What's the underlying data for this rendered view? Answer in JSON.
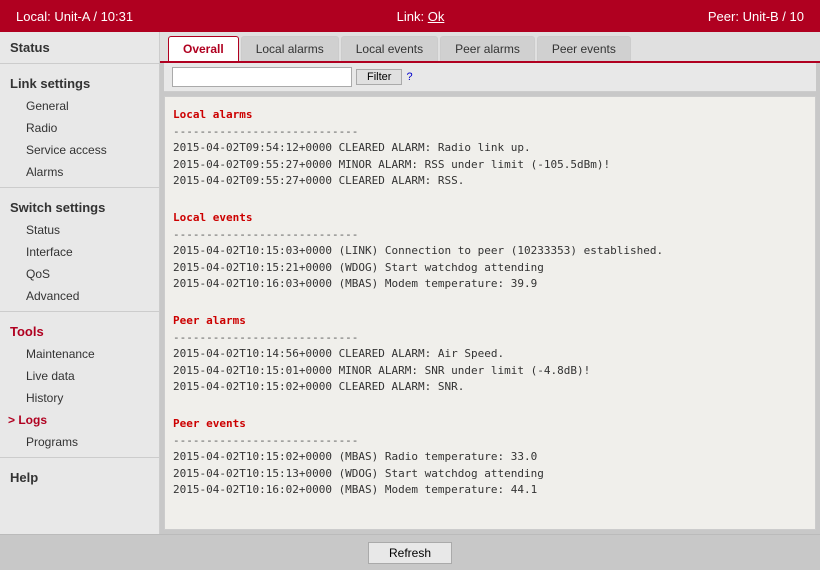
{
  "topbar": {
    "local_label": "Local:",
    "local_unit": "Unit-A",
    "local_time": "10:31",
    "link_label": "Link:",
    "link_status": "Ok",
    "peer_label": "Peer:",
    "peer_unit": "Unit-B / 10"
  },
  "sidebar": {
    "status_title": "Status",
    "link_settings_title": "Link settings",
    "link_items": [
      "General",
      "Radio",
      "Service access",
      "Alarms"
    ],
    "switch_settings_title": "Switch settings",
    "switch_items": [
      "Status",
      "Interface",
      "QoS",
      "Advanced"
    ],
    "tools_title": "Tools",
    "tools_items": [
      "Maintenance",
      "Live data",
      "History",
      "Logs",
      "Programs"
    ],
    "active_item": "Logs",
    "help_title": "Help"
  },
  "tabs": {
    "items": [
      "Overall",
      "Local alarms",
      "Local events",
      "Peer alarms",
      "Peer events"
    ],
    "active": "Overall"
  },
  "filter": {
    "placeholder": "",
    "button_label": "Filter",
    "help_label": "?"
  },
  "log": {
    "local_alarms_title": "Local alarms",
    "local_alarms_separator": "----------------------------",
    "local_alarms_lines": [
      "2015-04-02T09:54:12+0000 CLEARED ALARM: Radio link up.",
      "2015-04-02T09:55:27+0000 MINOR ALARM: RSS under limit (-105.5dBm)!",
      "2015-04-02T09:55:27+0000 CLEARED ALARM: RSS."
    ],
    "local_events_title": "Local events",
    "local_events_separator": "----------------------------",
    "local_events_lines": [
      "2015-04-02T10:15:03+0000 (LINK) Connection to peer (10233353) established.",
      "2015-04-02T10:15:21+0000 (WDOG) Start watchdog attending",
      "2015-04-02T10:16:03+0000 (MBAS) Modem temperature: 39.9"
    ],
    "peer_alarms_title": "Peer alarms",
    "peer_alarms_separator": "----------------------------",
    "peer_alarms_lines": [
      "2015-04-02T10:14:56+0000 CLEARED ALARM: Air Speed.",
      "2015-04-02T10:15:01+0000 MINOR ALARM: SNR under limit (-4.8dB)!",
      "2015-04-02T10:15:02+0000 CLEARED ALARM: SNR."
    ],
    "peer_events_title": "Peer events",
    "peer_events_separator": "----------------------------",
    "peer_events_lines": [
      "2015-04-02T10:15:02+0000 (MBAS) Radio temperature: 33.0",
      "2015-04-02T10:15:13+0000 (WDOG) Start watchdog attending",
      "2015-04-02T10:16:02+0000 (MBAS) Modem temperature: 44.1"
    ]
  },
  "bottom": {
    "refresh_label": "Refresh"
  }
}
